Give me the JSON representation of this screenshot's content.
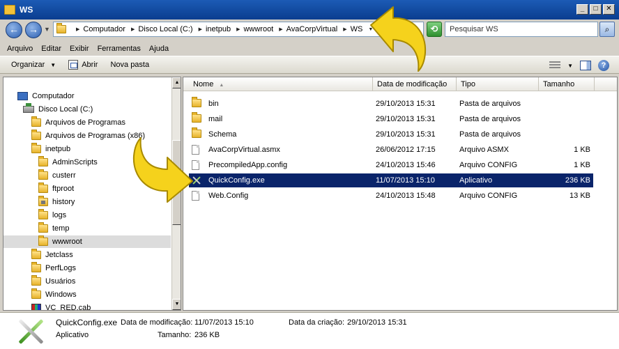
{
  "window": {
    "title": "WS"
  },
  "window_buttons": {
    "minimize": "_",
    "maximize": "□",
    "close": "✕"
  },
  "address": {
    "crumbs": [
      "Computador",
      "Disco Local (C:)",
      "inetpub",
      "wwwroot",
      "AvaCorpVirtual",
      "WS"
    ],
    "search_placeholder": "Pesquisar WS"
  },
  "menu": [
    "Arquivo",
    "Editar",
    "Exibir",
    "Ferramentas",
    "Ajuda"
  ],
  "toolbar": {
    "organize": "Organizar",
    "open": "Abrir",
    "new_folder": "Nova pasta"
  },
  "tree": [
    {
      "label": "Computador",
      "icon": "pc"
    },
    {
      "label": "Disco Local (C:)",
      "icon": "drive"
    },
    {
      "label": "Arquivos de Programas",
      "icon": "folder"
    },
    {
      "label": "Arquivos de Programas (x86)",
      "icon": "folder"
    },
    {
      "label": "inetpub",
      "icon": "folder"
    },
    {
      "label": "AdminScripts",
      "icon": "folder"
    },
    {
      "label": "custerr",
      "icon": "folder"
    },
    {
      "label": "ftproot",
      "icon": "folder"
    },
    {
      "label": "history",
      "icon": "folder-locked"
    },
    {
      "label": "logs",
      "icon": "folder"
    },
    {
      "label": "temp",
      "icon": "folder"
    },
    {
      "label": "wwwroot",
      "icon": "folder",
      "selected": true
    },
    {
      "label": "Jetclass",
      "icon": "folder"
    },
    {
      "label": "PerfLogs",
      "icon": "folder"
    },
    {
      "label": "Usuários",
      "icon": "folder"
    },
    {
      "label": "Windows",
      "icon": "folder"
    },
    {
      "label": "VC_RED.cab",
      "icon": "cab"
    }
  ],
  "columns": {
    "name": "Nome",
    "modified": "Data de modificação",
    "type": "Tipo",
    "size": "Tamanho"
  },
  "files": [
    {
      "name": "bin",
      "modified": "29/10/2013 15:31",
      "type": "Pasta de arquivos",
      "size": "",
      "icon": "folder"
    },
    {
      "name": "mail",
      "modified": "29/10/2013 15:31",
      "type": "Pasta de arquivos",
      "size": "",
      "icon": "folder"
    },
    {
      "name": "Schema",
      "modified": "29/10/2013 15:31",
      "type": "Pasta de arquivos",
      "size": "",
      "icon": "folder"
    },
    {
      "name": "AvaCorpVirtual.asmx",
      "modified": "26/06/2012 17:15",
      "type": "Arquivo ASMX",
      "size": "1 KB",
      "icon": "doc"
    },
    {
      "name": "PrecompiledApp.config",
      "modified": "24/10/2013 15:46",
      "type": "Arquivo CONFIG",
      "size": "1 KB",
      "icon": "doc"
    },
    {
      "name": "QuickConfig.exe",
      "modified": "11/07/2013 15:10",
      "type": "Aplicativo",
      "size": "236 KB",
      "icon": "exe",
      "selected": true
    },
    {
      "name": "Web.Config",
      "modified": "24/10/2013 15:48",
      "type": "Arquivo CONFIG",
      "size": "13 KB",
      "icon": "doc"
    }
  ],
  "status": {
    "name": "QuickConfig.exe",
    "modified_label": "Data de modificação:",
    "modified_value": "11/07/2013 15:10",
    "created_label": "Data da criação:",
    "created_value": "29/10/2013 15:31",
    "type": "Aplicativo",
    "size_label": "Tamanho:",
    "size_value": "236 KB"
  },
  "colors": {
    "selection": "#0a246a",
    "arrow_fill": "#f5d21c",
    "arrow_edge": "#a88a00"
  }
}
